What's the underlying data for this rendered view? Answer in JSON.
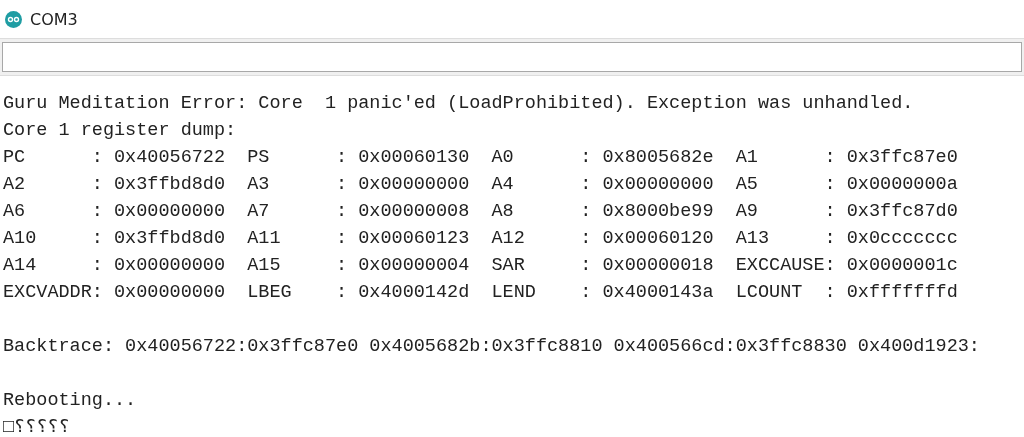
{
  "window": {
    "title": "COM3"
  },
  "output": {
    "paragraphs": [
      [
        "Guru Meditation Error: Core  1 panic'ed (LoadProhibited). Exception was unhandled.",
        "Core 1 register dump:",
        "PC      : 0x40056722  PS      : 0x00060130  A0      : 0x8005682e  A1      : 0x3ffc87e0",
        "A2      : 0x3ffbd8d0  A3      : 0x00000000  A4      : 0x00000000  A5      : 0x0000000a",
        "A6      : 0x00000000  A7      : 0x00000008  A8      : 0x8000be99  A9      : 0x3ffc87d0",
        "A10     : 0x3ffbd8d0  A11     : 0x00060123  A12     : 0x00060120  A13     : 0x0ccccccc",
        "A14     : 0x00000000  A15     : 0x00000004  SAR     : 0x00000018  EXCCAUSE: 0x0000001c",
        "EXCVADDR: 0x00000000  LBEG    : 0x4000142d  LEND    : 0x4000143a  LCOUNT  : 0xfffffffd"
      ],
      [
        "Backtrace: 0x40056722:0x3ffc87e0 0x4005682b:0x3ffc8810 0x400566cd:0x3ffc8830 0x400d1923:"
      ],
      [
        "Rebooting...",
        "□⸮⸮⸮⸮⸮"
      ]
    ]
  }
}
